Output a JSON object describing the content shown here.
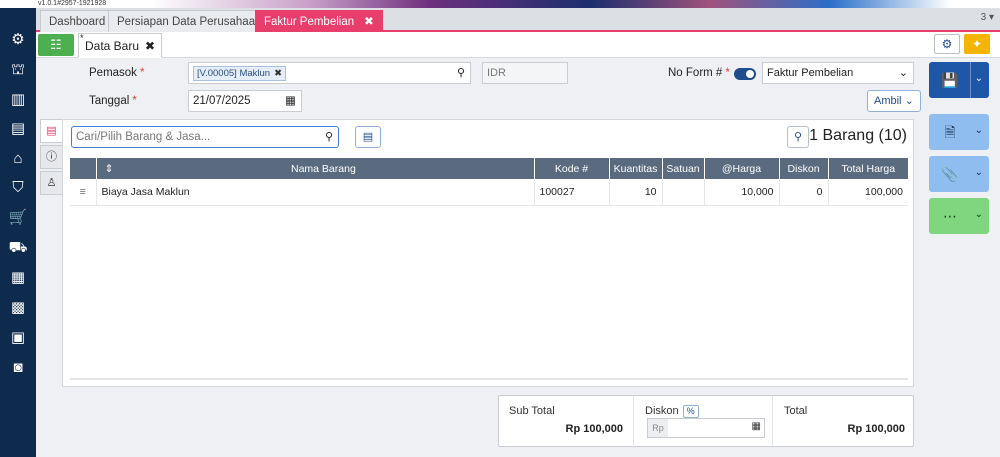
{
  "app": {
    "version": "v1.0.1#2957-1921928"
  },
  "tabs": [
    {
      "label": "Dashboard"
    },
    {
      "label": "Persiapan Data Perusahaan"
    },
    {
      "label": "Faktur Pembelian",
      "active": true
    }
  ],
  "tab_count": "3",
  "subtab": {
    "star": "*",
    "label": "Data Baru"
  },
  "form": {
    "pemasok_label": "Pemasok",
    "pemasok_value": "[V.00005] Maklun",
    "currency": "IDR",
    "no_form_label": "No Form #",
    "form_type": "Faktur Pembelian",
    "tanggal_label": "Tanggal",
    "tanggal_value": "21/07/2025",
    "ambil_label": "Ambil"
  },
  "items": {
    "search_placeholder": "Cari/Pilih Barang & Jasa...",
    "count_text": "1 Barang (10)",
    "columns": [
      "Nama Barang",
      "Kode #",
      "Kuantitas",
      "Satuan",
      "@Harga",
      "Diskon",
      "Total Harga"
    ],
    "rows": [
      {
        "nama": "Biaya Jasa Maklun",
        "kode": "100027",
        "qty": "10",
        "satuan": "",
        "harga": "10,000",
        "diskon": "0",
        "total": "100,000"
      }
    ]
  },
  "totals": {
    "subtotal_label": "Sub Total",
    "subtotal_value": "Rp 100,000",
    "diskon_label": "Diskon",
    "diskon_pct": "%",
    "diskon_prefix": "Rp",
    "total_label": "Total",
    "total_value": "Rp 100,000"
  },
  "colors": {
    "accent": "#e83e6c",
    "sidebar": "#0e2a4d",
    "save": "#1e56a8",
    "light_blue": "#8fbdf0",
    "green": "#7fd67f",
    "header": "#5a6b80"
  }
}
